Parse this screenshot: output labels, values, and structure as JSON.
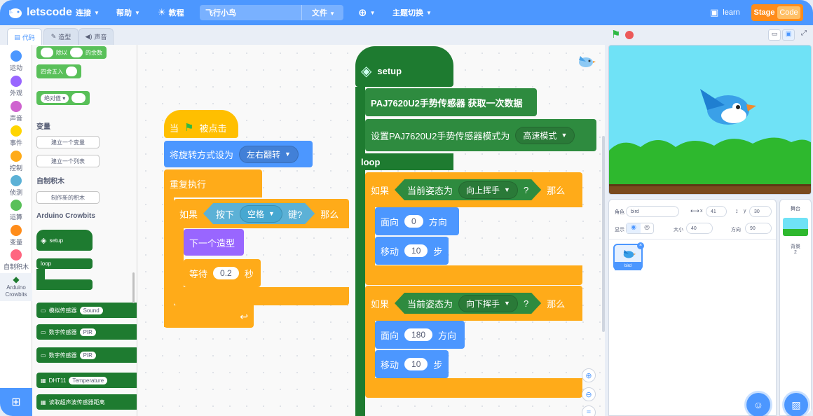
{
  "topbar": {
    "brand": "letscode",
    "menu_connect": "连接",
    "menu_help": "帮助",
    "menu_tutorial": "教程",
    "project_name": "飞行小鸟",
    "menu_file": "文件",
    "menu_theme": "主题切换",
    "learn": "learn",
    "stage_label": "Stage",
    "code_label": "Code"
  },
  "tabs": {
    "code": "代码",
    "costumes": "造型",
    "sounds": "声音"
  },
  "categories": [
    {
      "label": "运动",
      "color": "#4c97ff"
    },
    {
      "label": "外观",
      "color": "#9966ff"
    },
    {
      "label": "声音",
      "color": "#cf63cf"
    },
    {
      "label": "事件",
      "color": "#ffd500"
    },
    {
      "label": "控制",
      "color": "#ffab19"
    },
    {
      "label": "侦测",
      "color": "#5cb1d6"
    },
    {
      "label": "运算",
      "color": "#59c059"
    },
    {
      "label": "变量",
      "color": "#ff8c1a"
    },
    {
      "label": "自制积木",
      "color": "#ff6680"
    },
    {
      "label": "Arduino Crowbits",
      "color": "#1e7b30"
    }
  ],
  "palette": {
    "op_round": "除以",
    "op_remainder": "的余数",
    "op_rounding": "四舍五入",
    "op_abs": "绝对值",
    "variables_title": "变量",
    "make_variable": "建立一个变量",
    "make_list": "建立一个列表",
    "myblocks_title": "自制积木",
    "make_block": "制作新的积木",
    "arduino_title": "Arduino Crowbits",
    "setup": "setup",
    "loop": "loop",
    "sensors": [
      {
        "label": "模拟传感器",
        "opt": "Sound"
      },
      {
        "label": "数字传感器",
        "opt": "PIR"
      },
      {
        "label": "数字传感器",
        "opt": "PIR"
      },
      {
        "label": "DHT11",
        "opt": "Temperature"
      },
      {
        "label": "读取超声波传感器距离",
        "opt": ""
      }
    ]
  },
  "script1": {
    "hat_when": "当",
    "hat_clicked": "被点击",
    "set_rotation": "将旋转方式设为",
    "rotation_value": "左右翻转",
    "forever": "重复执行",
    "if": "如果",
    "key_pressed_pre": "按下",
    "key_value": "空格",
    "key_pressed_post": "键?",
    "then": "那么",
    "next_costume": "下一个造型",
    "wait": "等待",
    "wait_value": "0.2",
    "wait_unit": "秒"
  },
  "script2": {
    "setup": "setup",
    "read_gesture": "PAJ7620U2手势传感器 获取一次数据",
    "set_mode": "设置PAJ7620U2手势传感器模式为",
    "mode_value": "高速模式",
    "loop": "loop",
    "if1": "如果",
    "gesture_is": "当前姿态为",
    "gesture1": "向上挥手",
    "q": "?",
    "then1": "那么",
    "point_dir": "面向",
    "dir1": "0",
    "dir_unit": "方向",
    "move": "移动",
    "steps1": "10",
    "steps_unit": "步",
    "if2": "如果",
    "gesture2": "向下挥手",
    "then2": "那么",
    "dir2": "180",
    "steps2": "10"
  },
  "sprite_info": {
    "sprite_label": "角色",
    "sprite_name": "bird",
    "x_label": "x",
    "x": "41",
    "y_label": "y",
    "y": "30",
    "show_label": "显示",
    "size_label": "大小",
    "size": "40",
    "direction_label": "方向",
    "direction": "90",
    "thumb_label": "bird"
  },
  "stage_panel": {
    "title": "舞台",
    "backdrops_label": "背景",
    "backdrops_count": "2"
  },
  "colors": {
    "brand": "#4c97ff",
    "accent": "#ff8c1a"
  }
}
